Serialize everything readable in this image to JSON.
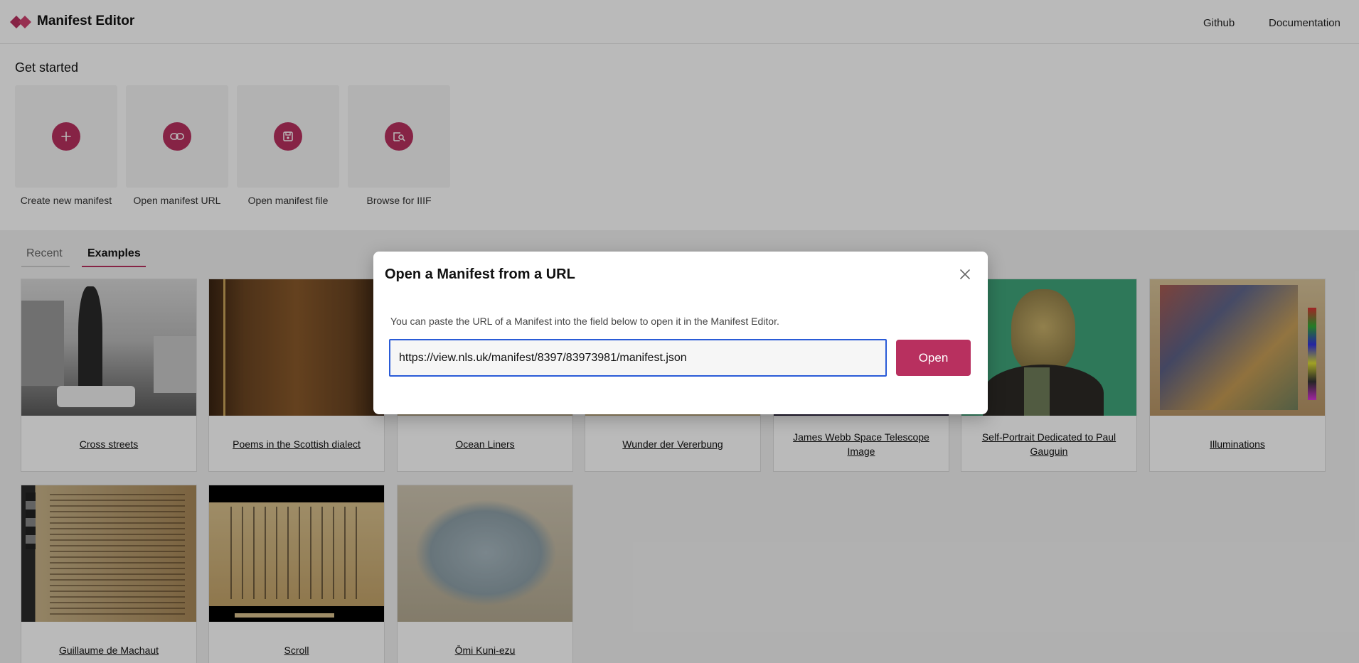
{
  "app": {
    "title": "Manifest Editor",
    "brand_color": "#b8305f",
    "nav": [
      "Github",
      "Documentation"
    ]
  },
  "get_started": {
    "heading": "Get started",
    "actions": [
      {
        "label": "Create new manifest",
        "icon": "plus-icon"
      },
      {
        "label": "Open manifest URL",
        "icon": "link-icon"
      },
      {
        "label": "Open manifest file",
        "icon": "save-file-icon"
      },
      {
        "label": "Browse for IIIF",
        "icon": "browse-image-icon"
      }
    ]
  },
  "tabs": [
    {
      "label": "Recent",
      "active": false
    },
    {
      "label": "Examples",
      "active": true
    }
  ],
  "examples": [
    {
      "title": "Cross streets"
    },
    {
      "title": "Poems in the Scottish dialect"
    },
    {
      "title": "Ocean Liners"
    },
    {
      "title": "Wunder der Vererbung"
    },
    {
      "title": "James Webb Space Telescope Image"
    },
    {
      "title": "Self-Portrait Dedicated to Paul Gauguin"
    },
    {
      "title": "Illuminations"
    },
    {
      "title": "Guillaume de Machaut"
    },
    {
      "title": "Scroll"
    },
    {
      "title": "Ōmi Kuni-ezu"
    }
  ],
  "modal": {
    "title": "Open a Manifest from a URL",
    "description": "You can paste the URL of a Manifest into the field below to open it in the Manifest Editor.",
    "url_value": "https://view.nls.uk/manifest/8397/83973981/manifest.json",
    "open_label": "Open"
  }
}
